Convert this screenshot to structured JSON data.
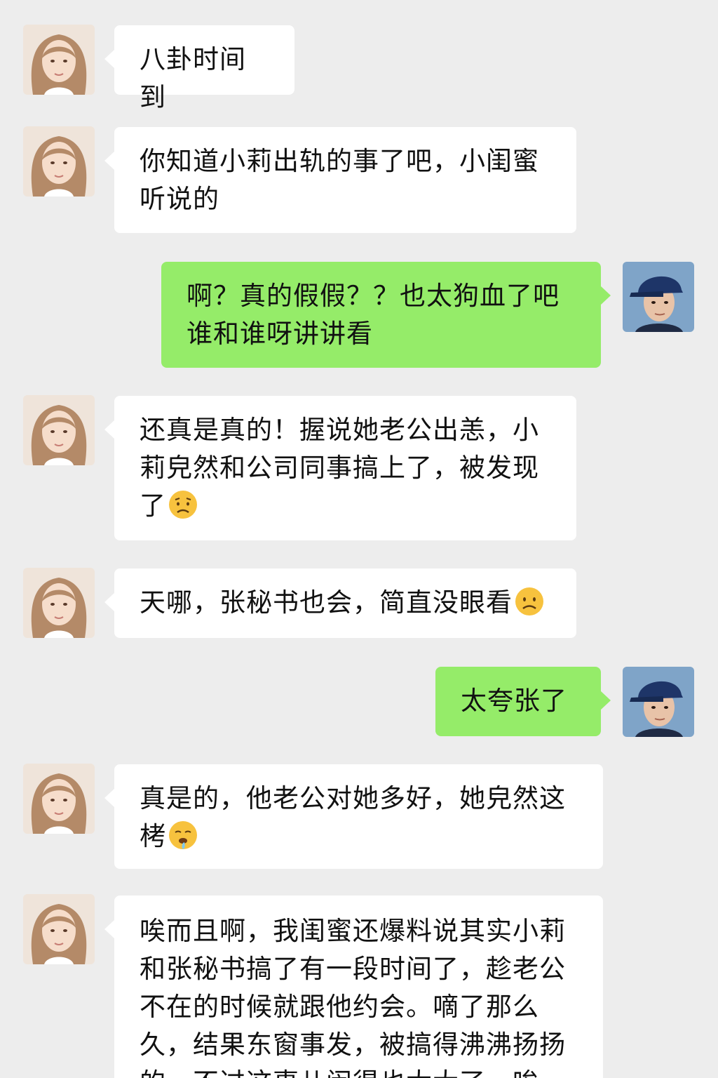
{
  "messages": [
    {
      "side": "left",
      "text": "八卦时间到",
      "emoji": ""
    },
    {
      "side": "left",
      "text": "你知道小莉出轨的事了吧，小闺蜜听说的",
      "emoji": ""
    },
    {
      "side": "right",
      "text": "啊？真的假假？？也太狗血了吧谁和谁呀讲讲看",
      "emoji": ""
    },
    {
      "side": "left",
      "text": "还真是真的！握说她老公出恙，小莉皃然和公司同事搞上了，被发现了",
      "emoji": "worried-face"
    },
    {
      "side": "left",
      "text": "天哪，张秘书也会，简直没眼看",
      "emoji": "frowning-face"
    },
    {
      "side": "right",
      "text": "太夸张了",
      "emoji": ""
    },
    {
      "side": "left",
      "text": "真是的，他老公对她多好，她皃然这栲",
      "emoji": "drooling-face"
    },
    {
      "side": "left",
      "text": "唉而且啊，我闺蜜还爆料说其实小莉和张秘书搞了有一段时间了，趁老公不在的时候就跟他约会。嘀了那么久，结果东窗事发，被搞得沸沸扬扬的，不过这事儿闹得也太大了，唉",
      "emoji": ""
    }
  ],
  "colors": {
    "background": "#ededed",
    "left_bubble": "#ffffff",
    "right_bubble": "#95ec69"
  }
}
